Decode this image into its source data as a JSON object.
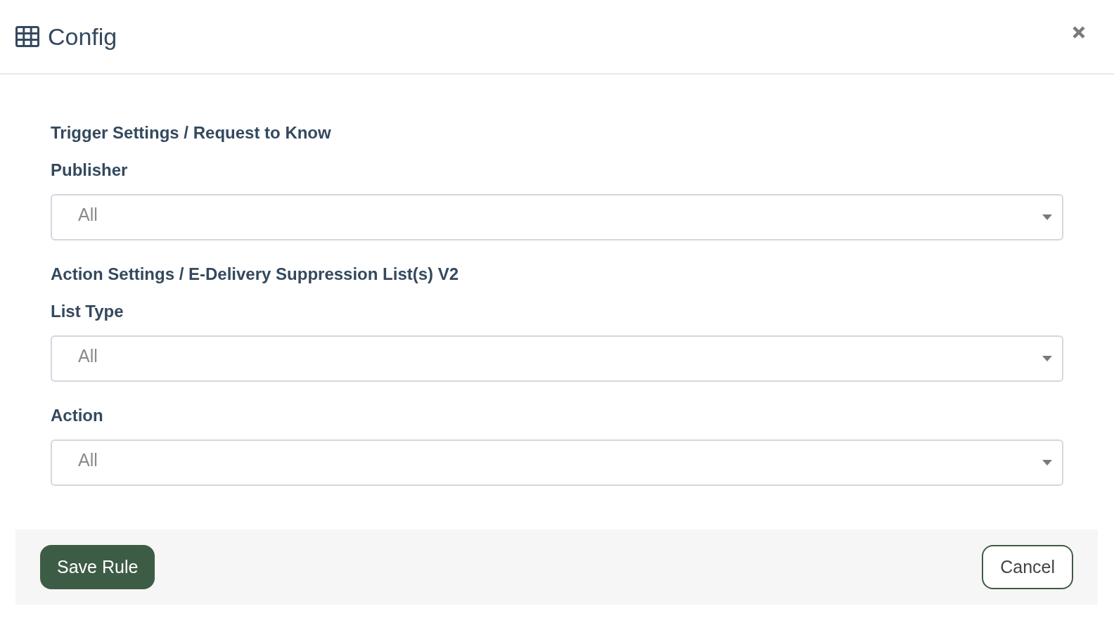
{
  "dialog": {
    "title": "Config"
  },
  "sections": [
    {
      "heading": "Trigger Settings / Request to Know",
      "fields": [
        {
          "label": "Publisher",
          "value": "All"
        }
      ]
    },
    {
      "heading": "Action Settings / E-Delivery Suppression List(s) V2",
      "fields": [
        {
          "label": "List Type",
          "value": "All"
        },
        {
          "label": "Action",
          "value": "All"
        }
      ]
    }
  ],
  "buttons": [
    {
      "label": "Save Rule",
      "kind": "primary"
    },
    {
      "label": "Cancel",
      "kind": "secondary"
    }
  ]
}
